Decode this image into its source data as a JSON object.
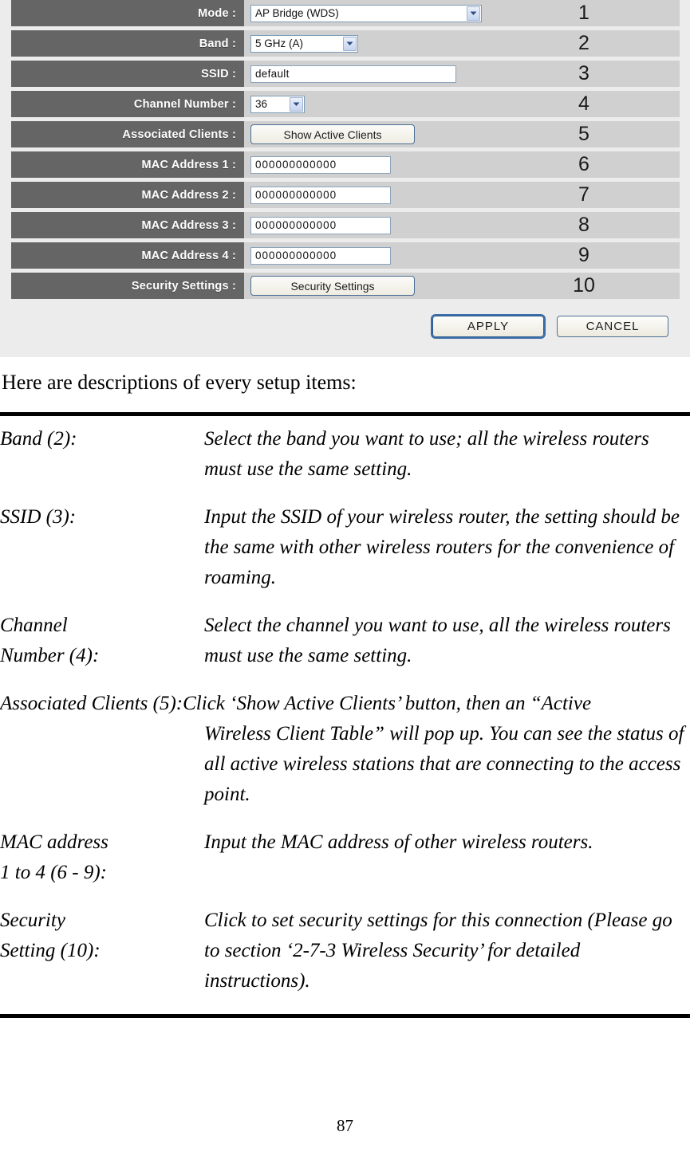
{
  "panel": {
    "rows": [
      {
        "label": "Mode :",
        "number": "1",
        "control": "select",
        "value": "AP Bridge (WDS)",
        "control_class": "sel-mode"
      },
      {
        "label": "Band :",
        "number": "2",
        "control": "select",
        "value": "5 GHz (A)",
        "control_class": "sel-band"
      },
      {
        "label": "SSID :",
        "number": "3",
        "control": "text",
        "value": "default",
        "control_class": "txt-ssid"
      },
      {
        "label": "Channel Number :",
        "number": "4",
        "control": "select",
        "value": "36",
        "control_class": "sel-chan"
      },
      {
        "label": "Associated Clients :",
        "number": "5",
        "control": "button",
        "value": "Show Active Clients",
        "control_class": ""
      },
      {
        "label": "MAC Address 1 :",
        "number": "6",
        "control": "text",
        "value": "000000000000",
        "control_class": "txt-mac"
      },
      {
        "label": "MAC Address 2 :",
        "number": "7",
        "control": "text",
        "value": "000000000000",
        "control_class": "txt-mac"
      },
      {
        "label": "MAC Address 3 :",
        "number": "8",
        "control": "text",
        "value": "000000000000",
        "control_class": "txt-mac"
      },
      {
        "label": "MAC Address 4 :",
        "number": "9",
        "control": "text",
        "value": "000000000000",
        "control_class": "txt-mac"
      },
      {
        "label": "Security Settings :",
        "number": "10",
        "control": "button",
        "value": "Security Settings",
        "control_class": ""
      }
    ],
    "apply_label": "APPLY",
    "cancel_label": "CANCEL",
    "colors": {
      "label_bg": "#656565",
      "row_bg": "#d0d0d0",
      "panel_bg": "#ececec",
      "label_text": "#ffffff",
      "button_border": "#4c6f96",
      "focus_ring": "#3b6ea8"
    }
  },
  "doc": {
    "intro": "Here are descriptions of every setup items:",
    "entries": [
      {
        "term": "Band (2):",
        "desc": "Select the band you want to use; all the wireless routers must use the same setting."
      },
      {
        "term": "SSID (3):",
        "desc": "Input the SSID of your wireless router, the setting should be the same with other wireless routers for the convenience of roaming."
      },
      {
        "term": "Channel\nNumber (4):",
        "desc": "Select the channel you want to use, all the wireless routers must use the same setting."
      },
      {
        "term": "Associated Clients (5):",
        "desc_lead": "Click ‘Show Active Clients’ button, then an “Active",
        "desc_rest": "Wireless Client Table” will pop up. You can see the status of all active wireless stations that are connecting to the access point.",
        "inline": true
      },
      {
        "term": "MAC address\n1 to 4 (6 - 9):",
        "desc": "Input the MAC address of other wireless routers."
      },
      {
        "term": "Security\nSetting (10):",
        "desc": "Click to set security settings for this connection (Please go to section ‘2-7-3 Wireless Security’ for detailed instructions)."
      }
    ],
    "page_number": "87"
  }
}
